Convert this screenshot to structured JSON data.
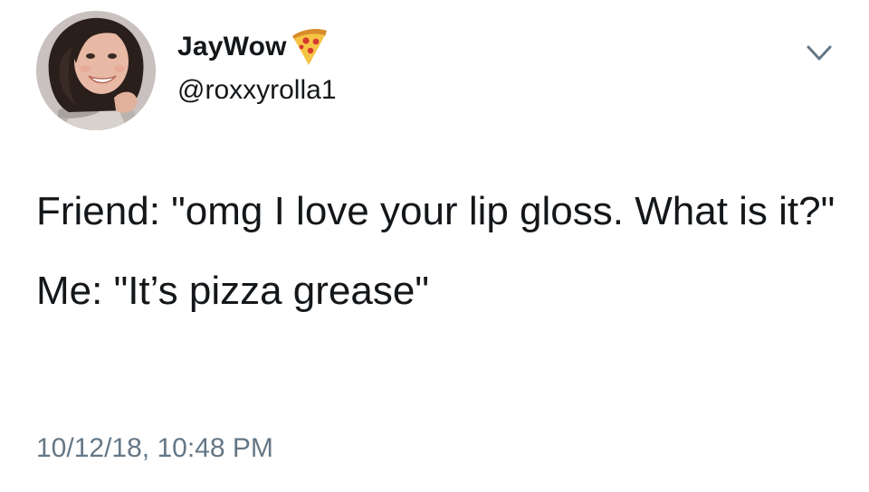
{
  "author": {
    "display_name": "JayWow",
    "handle": "@roxxyrolla1",
    "name_emoji": "pizza-icon"
  },
  "tweet": {
    "paragraph_1": "Friend: \"omg I love your lip gloss. What is it?\"",
    "paragraph_2": "Me: \"It’s pizza grease\"",
    "timestamp": "10/12/18, 10:48 PM"
  },
  "menu": {
    "icon": "chevron-down-icon"
  },
  "colors": {
    "text": "#14171a",
    "muted": "#657786",
    "chevron": "#657786"
  }
}
